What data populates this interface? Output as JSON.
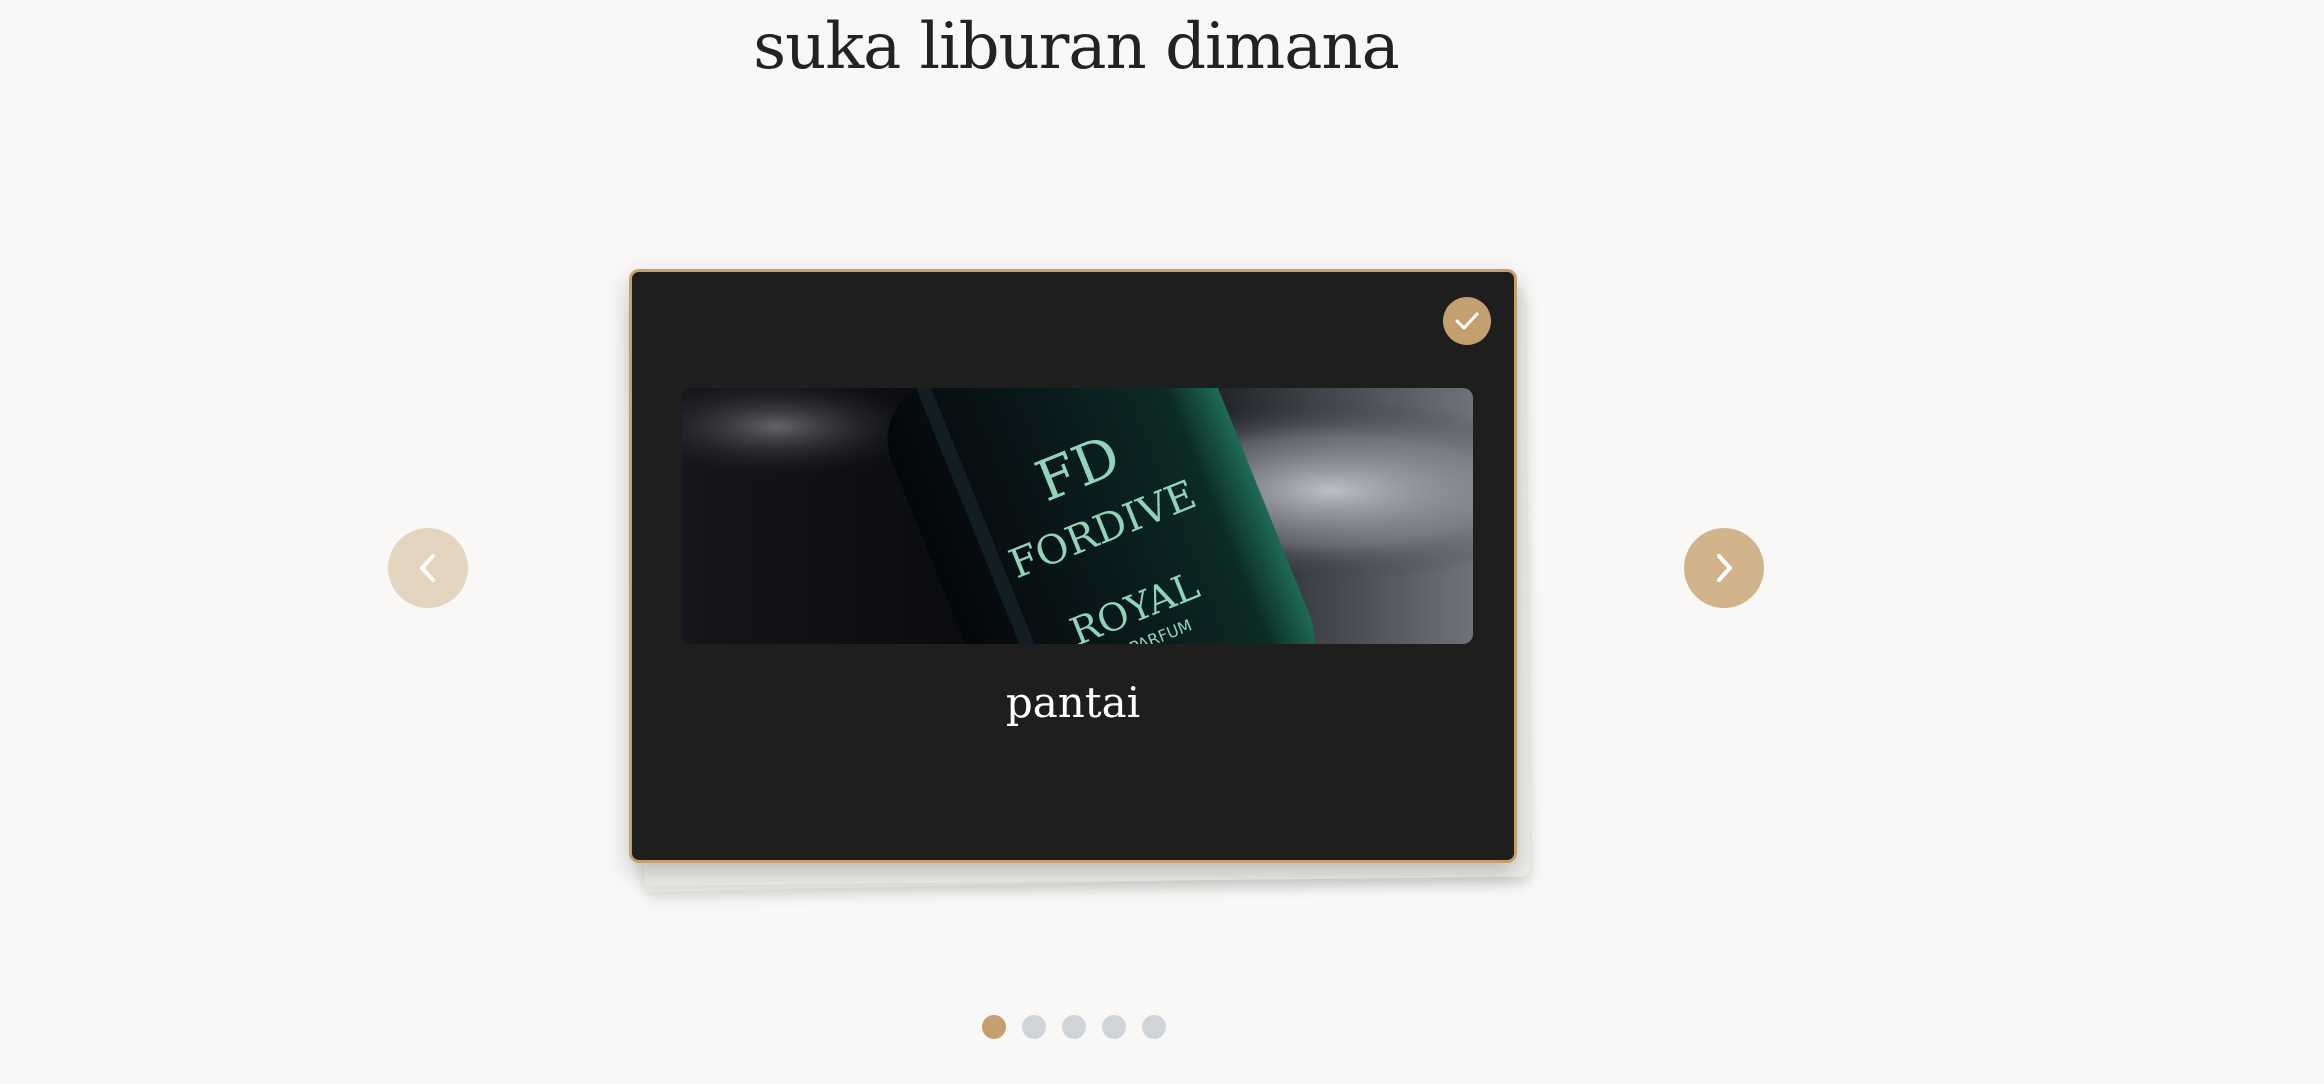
{
  "question": {
    "title": "suka liburan dimana"
  },
  "card": {
    "label": "pantai",
    "selected": true,
    "image": {
      "brand_text": "FORDIVE",
      "product_text": "ROYAL",
      "sub_text": "DE PARFUM"
    }
  },
  "navigation": {
    "prev_icon": "chevron-left-icon",
    "next_icon": "chevron-right-icon"
  },
  "pagination": {
    "total": 5,
    "active_index": 0
  },
  "colors": {
    "accent": "#c4a070",
    "card_bg": "#1e1e1e",
    "page_bg": "#faf8f6",
    "dot_inactive": "#d0d3d8",
    "prev_button": "#e4d5c0",
    "next_button": "#d2b48c"
  }
}
